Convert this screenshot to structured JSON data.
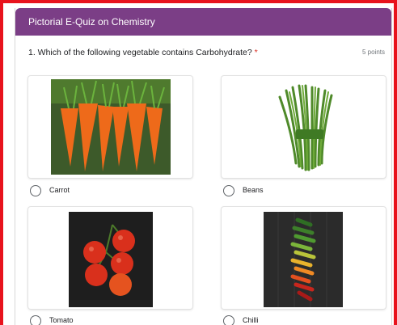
{
  "form": {
    "title": "Pictorial E-Quiz on Chemistry",
    "question": "1. Which of the following vegetable contains Carbohydrate?",
    "required_mark": "*",
    "points": "5 points"
  },
  "options": [
    {
      "label": "Carrot",
      "image": "carrot-image"
    },
    {
      "label": "Beans",
      "image": "beans-image"
    },
    {
      "label": "Tomato",
      "image": "tomato-image"
    },
    {
      "label": "Chilli",
      "image": "chilli-image"
    }
  ],
  "colors": {
    "header": "#7b3e86",
    "frame_border": "#e8131d",
    "required": "#d93025"
  }
}
